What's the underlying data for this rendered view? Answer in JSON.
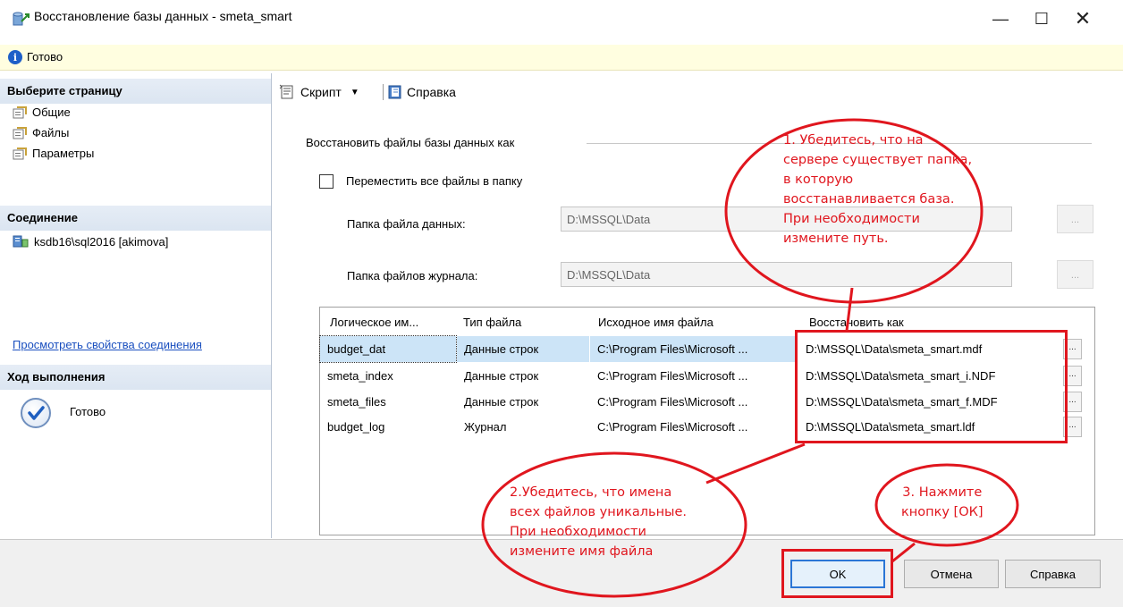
{
  "window": {
    "title": "Восстановление базы данных - smeta_smart",
    "minimize": "—",
    "maximize": "☐",
    "close": "✕"
  },
  "status": {
    "text": "Готово"
  },
  "left_pane": {
    "select_page_header": "Выберите страницу",
    "pages": [
      {
        "label": "Общие",
        "icon": "page-icon"
      },
      {
        "label": "Файлы",
        "icon": "page-icon"
      },
      {
        "label": "Параметры",
        "icon": "page-icon"
      }
    ],
    "connection_header": "Соединение",
    "connection_server": "ksdb16\\sql2016 [akimova]",
    "connection_link": "Просмотреть свойства соединения",
    "progress_header": "Ход выполнения",
    "progress_status": "Готово"
  },
  "toolbar": {
    "script_label": "Скрипт",
    "help_label": "Справка"
  },
  "restore_files": {
    "group_title": "Восстановить файлы базы данных как",
    "move_all_label": "Переместить все файлы в папку",
    "data_folder_label": "Папка файла данных:",
    "data_folder_value": "D:\\MSSQL\\Data",
    "log_folder_label": "Папка файлов журнала:",
    "log_folder_value": "D:\\MSSQL\\Data",
    "browse_label": "...",
    "grid": {
      "columns": [
        "Логическое им...",
        "Тип файла",
        "Исходное имя файла",
        "Восстановить как"
      ],
      "rows": [
        [
          "budget_dat",
          "Данные строк",
          "C:\\Program Files\\Microsoft ...",
          "D:\\MSSQL\\Data\\smeta_smart.mdf"
        ],
        [
          "smeta_index",
          "Данные строк",
          "C:\\Program Files\\Microsoft ...",
          "D:\\MSSQL\\Data\\smeta_smart_i.NDF"
        ],
        [
          "smeta_files",
          "Данные строк",
          "C:\\Program Files\\Microsoft ...",
          "D:\\MSSQL\\Data\\smeta_smart_f.MDF"
        ],
        [
          "budget_log",
          "Журнал",
          "C:\\Program Files\\Microsoft ...",
          "D:\\MSSQL\\Data\\smeta_smart.ldf"
        ]
      ],
      "cell_button": "..."
    }
  },
  "buttons": {
    "ok": "OK",
    "cancel": "Отмена",
    "help": "Справка"
  },
  "annotations": {
    "note1": [
      "1. Убедитесь, что на",
      "сервере существует папка,",
      "в которую",
      "восстанавливается база.",
      "При необходимости",
      "измените путь."
    ],
    "note2": [
      "2.Убедитесь, что имена",
      "всех файлов уникальные.",
      "При необходимости",
      "измените имя файла"
    ],
    "note3": [
      "3. Нажмите",
      "кнопку [ОК]"
    ],
    "color": "#e0161e"
  },
  "colors": {
    "accent": "#2b76d6",
    "status_bg": "#fffee0",
    "selected_row": "#cce4f7",
    "link": "#1a4fbf"
  }
}
